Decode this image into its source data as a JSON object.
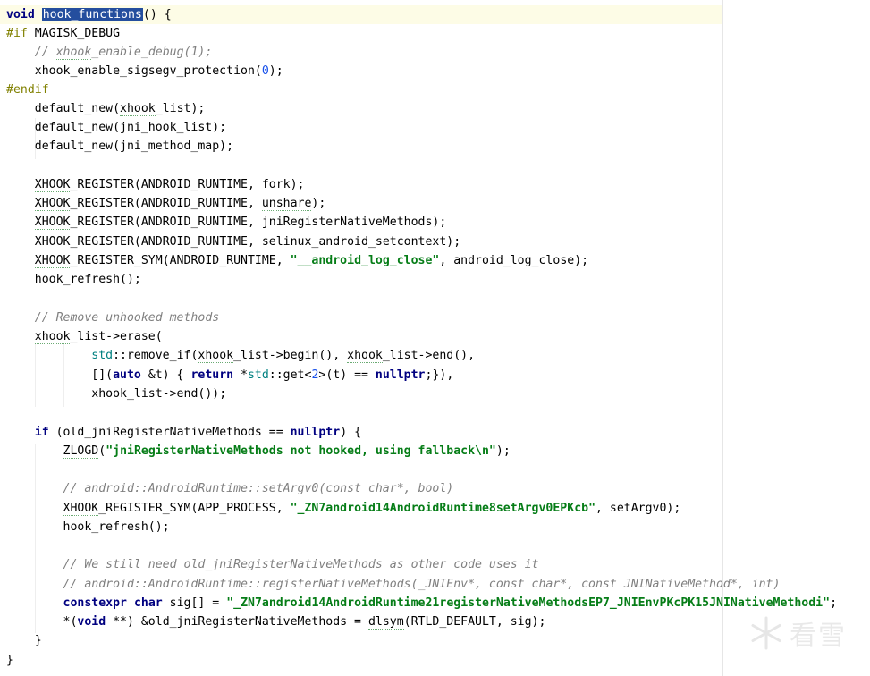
{
  "code": {
    "l01": {
      "a": "void",
      "b": " ",
      "c": "hook_functions",
      "d": "() {"
    },
    "l02": {
      "a": "#if",
      "b": " MAGISK_DEBUG"
    },
    "l03": {
      "a": "    ",
      "b": "// ",
      "c": "xhook",
      "d": "_enable_debug(1);"
    },
    "l04": {
      "a": "    xhook_enable_sigsegv_protection(",
      "b": "0",
      "c": ");"
    },
    "l05": {
      "a": "#endif"
    },
    "l06": {
      "a": "    default_new(",
      "b": "xhook",
      "c": "_list);"
    },
    "l07": {
      "a": "    default_new(jni_hook_list);"
    },
    "l08": {
      "a": "    default_new(jni_method_map);"
    },
    "l10": {
      "a": "    ",
      "b": "XHOOK",
      "c": "_REGISTER(ANDROID_RUNTIME, fork);"
    },
    "l11": {
      "a": "    ",
      "b": "XHOOK",
      "c": "_REGISTER(ANDROID_RUNTIME, ",
      "d": "unshare",
      "e": ");"
    },
    "l12": {
      "a": "    ",
      "b": "XHOOK",
      "c": "_REGISTER(ANDROID_RUNTIME, jniRegisterNativeMethods);"
    },
    "l13": {
      "a": "    ",
      "b": "XHOOK",
      "c": "_REGISTER(ANDROID_RUNTIME, ",
      "d": "selinux",
      "e": "_android_setcontext);"
    },
    "l14": {
      "a": "    ",
      "b": "XHOOK",
      "c": "_REGISTER_SYM(ANDROID_RUNTIME, ",
      "d": "\"__android_log_close\"",
      "e": ", android_log_close);"
    },
    "l15": {
      "a": "    hook_refresh();"
    },
    "l17": {
      "a": "    ",
      "b": "// Remove unhooked methods"
    },
    "l18": {
      "a": "    ",
      "b": "xhook",
      "c": "_list->erase("
    },
    "l19": {
      "a": "            ",
      "b": "std",
      "c": "::remove_if(",
      "d": "xhook",
      "e": "_list->begin(), ",
      "f": "xhook",
      "g": "_list->end(),"
    },
    "l20": {
      "a": "            [](",
      "b": "auto",
      "c": " &t) { ",
      "d": "return",
      "e": " *",
      "f": "std",
      "g": "::get<",
      "h": "2",
      "i": ">(t) == ",
      "j": "nullptr",
      "k": ";}),"
    },
    "l21": {
      "a": "            ",
      "b": "xhook",
      "c": "_list->end());"
    },
    "l23": {
      "a": "    ",
      "b": "if",
      "c": " (old_jniRegisterNativeMethods == ",
      "d": "nullptr",
      "e": ") {"
    },
    "l24": {
      "a": "        ",
      "b": "ZLOGD",
      "c": "(",
      "d": "\"jniRegisterNativeMethods not hooked, using fallback\\n\"",
      "e": ");"
    },
    "l26": {
      "a": "        ",
      "b": "// android::AndroidRuntime::setArgv0(const char*, bool)"
    },
    "l27": {
      "a": "        ",
      "b": "XHOOK",
      "c": "_REGISTER_SYM(APP_PROCESS, ",
      "d": "\"_ZN7android14AndroidRuntime8setArgv0EPKcb\"",
      "e": ", setArgv0);"
    },
    "l28": {
      "a": "        hook_refresh();"
    },
    "l30": {
      "a": "        ",
      "b": "// We still need old_jniRegisterNativeMethods as other code uses it"
    },
    "l31": {
      "a": "        ",
      "b": "// android::AndroidRuntime::registerNativeMethods(_JNIEnv*, const char*, const JNINativeMethod*, int)"
    },
    "l32": {
      "a": "        ",
      "b": "constexpr",
      "c": " ",
      "d": "char",
      "e": " sig[] = ",
      "f": "\"_ZN7android14AndroidRuntime21registerNativeMethodsEP7_JNIEnvPKcPK15JNINativeMethodi\"",
      "g": ";"
    },
    "l33": {
      "a": "        *(",
      "b": "void",
      "c": " **) &old_jniRegisterNativeMethods = ",
      "d": "dlsym",
      "e": "(RTLD_DEFAULT, sig);"
    },
    "l34": {
      "a": "    }"
    },
    "l35": {
      "a": "}"
    }
  },
  "watermark": {
    "text": "看雪",
    "icon": "snowflake-icon"
  },
  "colors": {
    "keyword": "#000080",
    "preprocessor": "#808000",
    "comment": "#808080",
    "string": "#067d17",
    "number": "#1750eb",
    "namespace": "#008080",
    "selection": "#244e9e",
    "current_line": "#fdfce6"
  }
}
